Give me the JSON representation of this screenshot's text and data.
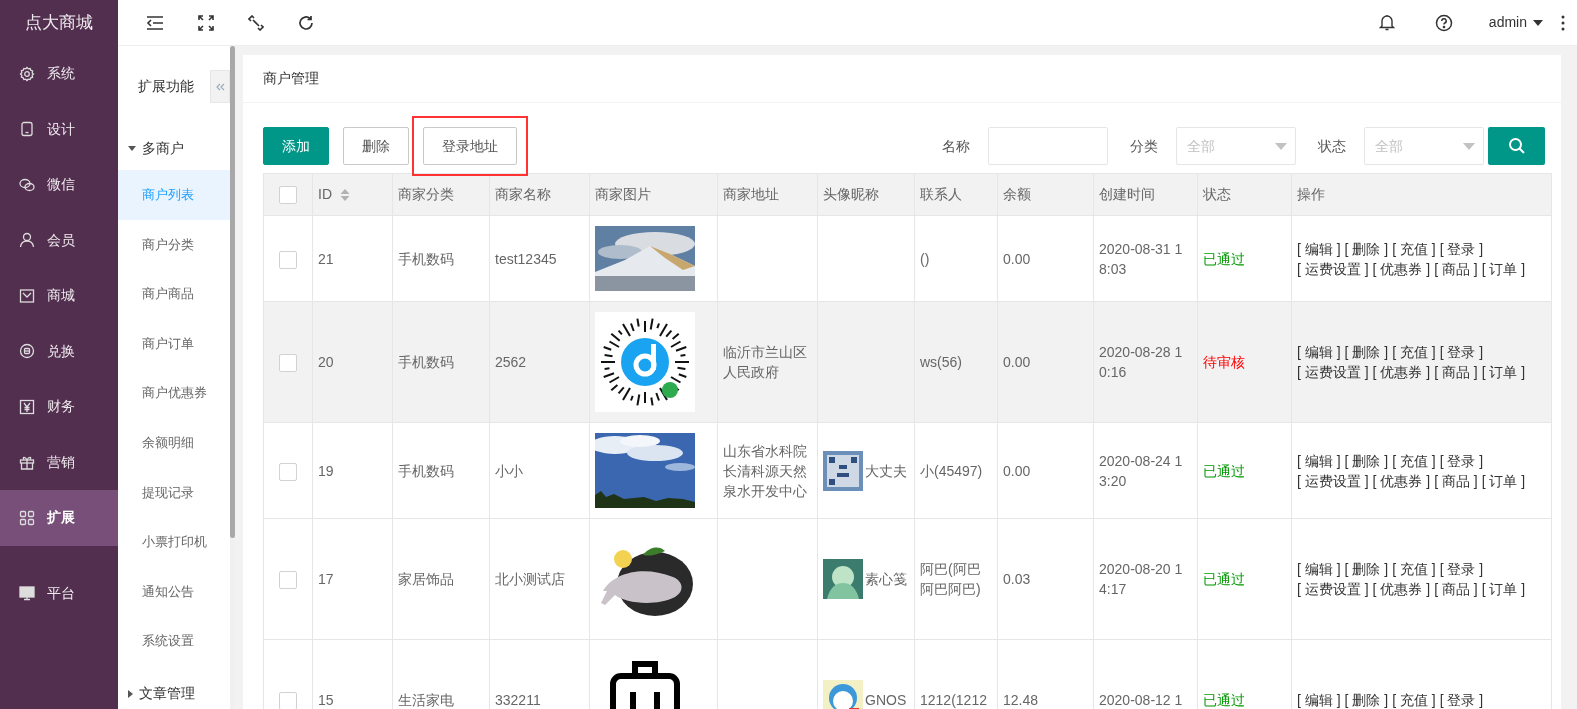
{
  "brand": "点大商城",
  "nav": [
    {
      "label": "系统",
      "selected": false
    },
    {
      "label": "设计",
      "selected": false
    },
    {
      "label": "微信",
      "selected": false
    },
    {
      "label": "会员",
      "selected": false
    },
    {
      "label": "商城",
      "selected": false
    },
    {
      "label": "兑换",
      "selected": false
    },
    {
      "label": "财务",
      "selected": false
    },
    {
      "label": "营销",
      "selected": false
    },
    {
      "label": "扩展",
      "selected": true
    },
    {
      "label": "平台",
      "selected": false
    }
  ],
  "user": "admin",
  "subnav": {
    "title": "扩展功能",
    "groups": [
      {
        "label": "多商户",
        "expanded": true,
        "children": [
          {
            "label": "商户列表",
            "selected": true
          },
          {
            "label": "商户分类",
            "selected": false
          },
          {
            "label": "商户商品",
            "selected": false
          },
          {
            "label": "商户订单",
            "selected": false
          },
          {
            "label": "商户优惠券",
            "selected": false
          },
          {
            "label": "余额明细",
            "selected": false
          },
          {
            "label": "提现记录",
            "selected": false
          },
          {
            "label": "小票打印机",
            "selected": false
          },
          {
            "label": "通知公告",
            "selected": false
          },
          {
            "label": "系统设置",
            "selected": false
          }
        ]
      },
      {
        "label": "文章管理",
        "expanded": false
      }
    ]
  },
  "page_title": "商户管理",
  "toolbar": {
    "buttons": [
      {
        "label": "添加",
        "kind": "primary"
      },
      {
        "label": "删除",
        "kind": "plain"
      },
      {
        "label": "登录地址",
        "kind": "plain",
        "highlighted": true
      }
    ],
    "filters": [
      {
        "label": "名称",
        "kind": "input"
      },
      {
        "label": "分类",
        "kind": "select",
        "placeholder": "全部"
      },
      {
        "label": "状态",
        "kind": "select",
        "placeholder": "全部"
      }
    ]
  },
  "table": {
    "header_checked": false,
    "columns": [
      "ID",
      "商家分类",
      "商家名称",
      "商家图片",
      "商家地址",
      "头像昵称",
      "联系人",
      "余额",
      "创建时间",
      "状态",
      "操作"
    ],
    "rows": [
      {
        "checked": false,
        "selected": false,
        "id": "21",
        "category": "手机数码",
        "name": "test12345",
        "address": "",
        "nickname": "",
        "contact": "()",
        "balance": "0.00",
        "created": "2020-08-31 18:03",
        "status": {
          "text": "已通过",
          "color": "#009900"
        },
        "actions": [
          [
            "[ 编辑 ]",
            "[ 删除 ]",
            "[ 充值 ]",
            "[ 登录 ]"
          ],
          [
            "[ 运费设置 ]",
            "[ 优惠券 ]",
            "[ 商品 ]",
            "[ 订单 ]"
          ]
        ]
      },
      {
        "checked": false,
        "selected": true,
        "id": "20",
        "category": "手机数码",
        "name": "2562",
        "address": "临沂市兰山区人民政府",
        "nickname": "",
        "contact": "ws(56)",
        "balance": "0.00",
        "created": "2020-08-28 10:16",
        "status": {
          "text": "待审核",
          "color": "#ff0000"
        },
        "actions": [
          [
            "[ 编辑 ]",
            "[ 删除 ]",
            "[ 充值 ]",
            "[ 登录 ]"
          ],
          [
            "[ 运费设置 ]",
            "[ 优惠券 ]",
            "[ 商品 ]",
            "[ 订单 ]"
          ]
        ]
      },
      {
        "checked": false,
        "selected": false,
        "id": "19",
        "category": "手机数码",
        "name": "小小",
        "address": "山东省水科院长清科源天然泉水开发中心",
        "avatar": {
          "kind": "picture"
        },
        "nickname": "大丈夫",
        "contact": "小(45497)",
        "balance": "0.00",
        "created": "2020-08-24 13:20",
        "status": {
          "text": "已通过",
          "color": "#009900"
        },
        "actions": [
          [
            "[ 编辑 ]",
            "[ 删除 ]",
            "[ 充值 ]",
            "[ 登录 ]"
          ],
          [
            "[ 运费设置 ]",
            "[ 优惠券 ]",
            "[ 商品 ]",
            "[ 订单 ]"
          ]
        ]
      },
      {
        "checked": false,
        "selected": false,
        "id": "17",
        "category": "家居饰品",
        "name": "北小测试店",
        "address": "",
        "avatar": {
          "kind": "picture"
        },
        "nickname": "素心笺",
        "contact": "阿巴(阿巴阿巴阿巴)",
        "balance": "0.03",
        "created": "2020-08-20 14:17",
        "status": {
          "text": "已通过",
          "color": "#009900"
        },
        "actions": [
          [
            "[ 编辑 ]",
            "[ 删除 ]",
            "[ 充值 ]",
            "[ 登录 ]"
          ],
          [
            "[ 运费设置 ]",
            "[ 优惠券 ]",
            "[ 商品 ]",
            "[ 订单 ]"
          ]
        ]
      },
      {
        "checked": false,
        "selected": false,
        "id": "15",
        "category": "生活家电",
        "name": "332211",
        "address": "",
        "avatar": {
          "kind": "picture"
        },
        "nickname": "GNOS",
        "contact": "1212(1212",
        "balance": "12.48",
        "created": "2020-08-12 1",
        "status": {
          "text": "已通过",
          "color": "#009900"
        },
        "actions": [
          [
            "[ 编辑 ]",
            "[ 删除 ]",
            "[ 充值 ]",
            "[ 登录 ]"
          ]
        ]
      }
    ]
  }
}
